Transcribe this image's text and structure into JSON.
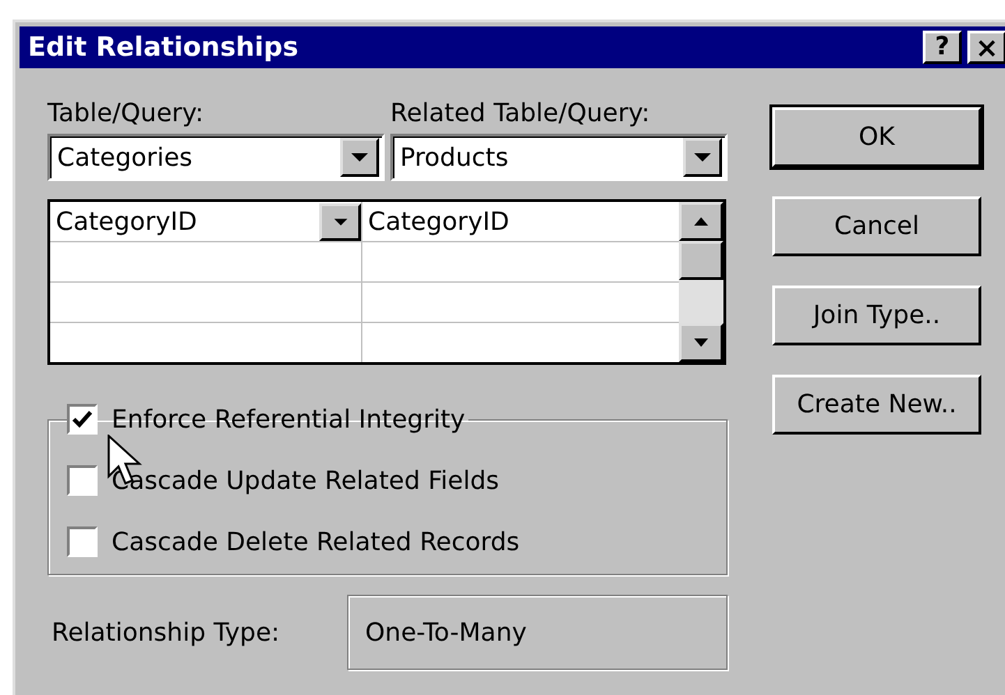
{
  "window": {
    "title": "Edit Relationships",
    "title_buttons": [
      {
        "kind": "help",
        "label": "?"
      },
      {
        "kind": "close",
        "label": "×"
      }
    ]
  },
  "table_query": {
    "label": "Table/Query:",
    "value": "Categories"
  },
  "related_table_query": {
    "label": "Related Table/Query:",
    "value": "Products"
  },
  "field_grid": {
    "rows": [
      {
        "column_1": "CategoryID",
        "column_2": "CategoryID"
      }
    ]
  },
  "options": [
    {
      "label": "Enforce Referential Integrity",
      "checked": true
    },
    {
      "label": "Cascade Update Related Fields",
      "checked": false
    },
    {
      "label": "Cascade Delete Related Records",
      "checked": false
    }
  ],
  "relationship_type": {
    "label": "Relationship Type:",
    "value": "One-To-Many"
  },
  "buttons": [
    {
      "label": "OK",
      "default": true
    },
    {
      "label": "Cancel",
      "default": false
    },
    {
      "label": "Join Type..",
      "default": false
    },
    {
      "label": "Create New..",
      "default": false
    }
  ]
}
